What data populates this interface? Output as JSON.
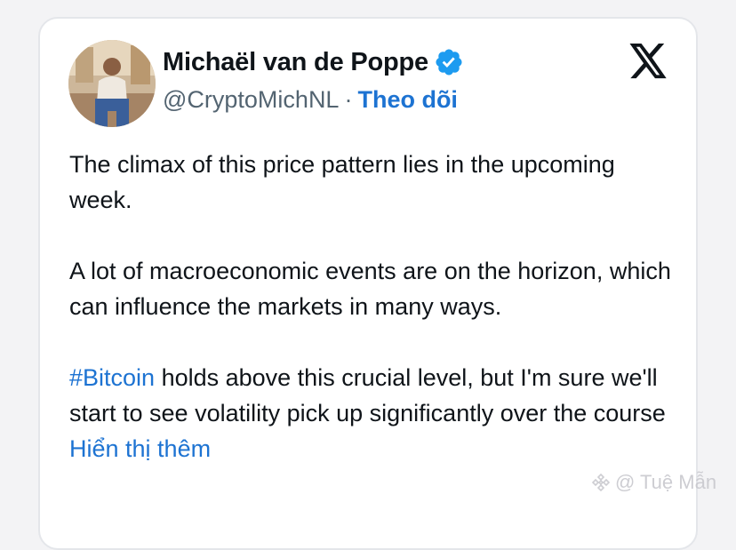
{
  "author": {
    "name": "Michaël van de Poppe",
    "handle": "@CryptoMichNL",
    "separator": "·",
    "follow_label": "Theo dõi",
    "verified_icon": "verified-badge-icon"
  },
  "platform_icon": "x-logo-icon",
  "tweet": {
    "paragraph_1": "The climax of this price pattern lies in the upcoming week.",
    "paragraph_2": "A lot of macroeconomic events are on the horizon, which can influence the markets in many ways.",
    "hashtag": "#Bitcoin",
    "paragraph_3_rest": " holds above this crucial level, but I'm sure we'll start to see volatility pick up significantly over the course ",
    "show_more_label": "Hiển thị thêm"
  },
  "watermark": {
    "text": "@ Tuệ Mẫn",
    "icon": "binance-logo-icon"
  },
  "colors": {
    "link_blue": "#1d73d2",
    "text_dark": "#0f1419",
    "text_gray": "#536471",
    "verified_blue": "#1d9bf0"
  }
}
